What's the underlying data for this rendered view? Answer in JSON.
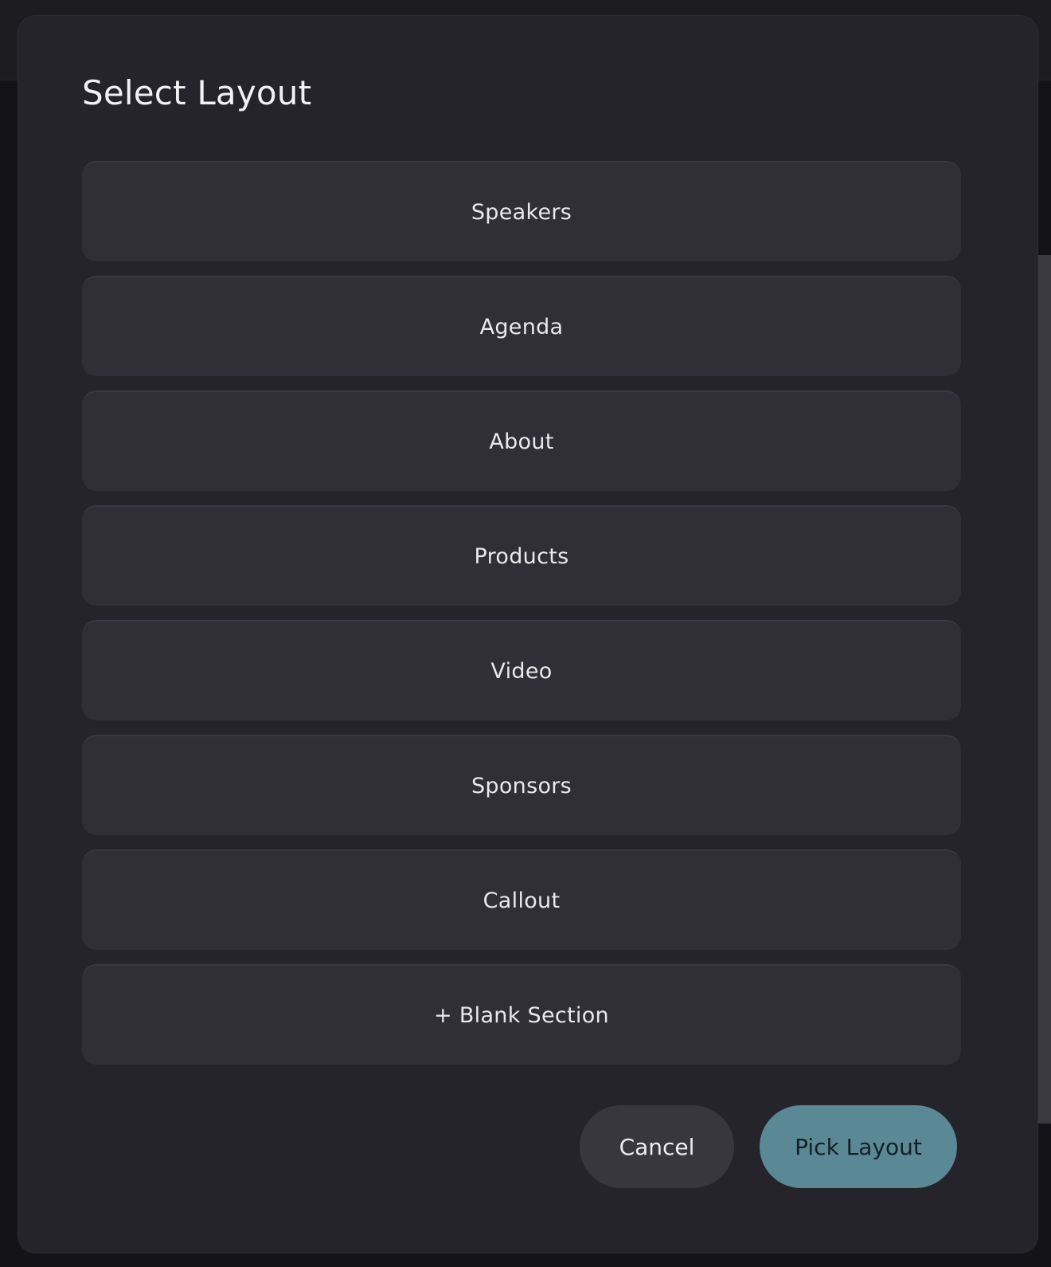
{
  "modal": {
    "title": "Select Layout"
  },
  "layouts": [
    {
      "label": "Speakers"
    },
    {
      "label": "Agenda"
    },
    {
      "label": "About"
    },
    {
      "label": "Products"
    },
    {
      "label": "Video"
    },
    {
      "label": "Sponsors"
    },
    {
      "label": "Callout"
    },
    {
      "label": "+ Blank Section"
    }
  ],
  "footer": {
    "cancel_label": "Cancel",
    "pick_label": "Pick Layout"
  },
  "colors": {
    "modal_bg": "#25242b",
    "option_bg": "#302f38",
    "primary_button": "#5a8895"
  }
}
